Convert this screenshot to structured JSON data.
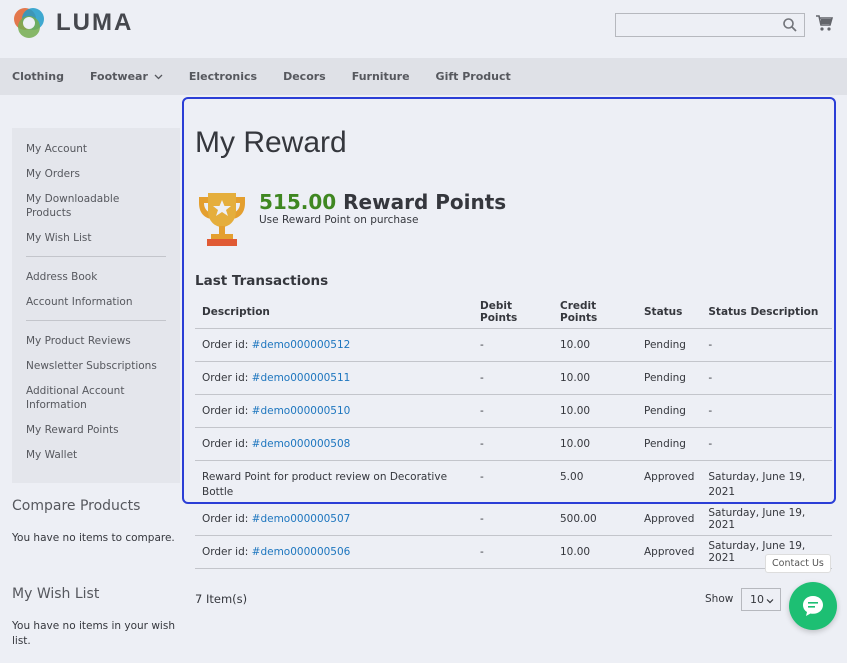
{
  "header": {
    "logo_text": "LUMA",
    "search": {
      "placeholder": ""
    }
  },
  "nav": {
    "items": [
      "Clothing",
      "Footwear",
      "Electronics",
      "Decors",
      "Furniture",
      "Gift Product"
    ]
  },
  "sidebar": {
    "group1": [
      "My Account",
      "My Orders",
      "My Downloadable Products",
      "My Wish List"
    ],
    "group2": [
      "Address Book",
      "Account Information"
    ],
    "group3": [
      "My Product Reviews",
      "Newsletter Subscriptions",
      "Additional Account Information",
      "My Reward Points",
      "My Wallet"
    ]
  },
  "compare": {
    "title": "Compare Products",
    "text": "You have no items to compare."
  },
  "wishlist": {
    "title": "My Wish List",
    "text": "You have no items in your wish list."
  },
  "main": {
    "title": "My Reward",
    "points_value": "515.00",
    "points_label": "Reward Points",
    "points_sub": "Use Reward Point on purchase",
    "section_title": "Last Transactions",
    "columns": [
      "Description",
      "Debit Points",
      "Credit Points",
      "Status",
      "Status Description"
    ],
    "rows": [
      {
        "prefix": "Order id: ",
        "link": "#demo000000512",
        "debit": "-",
        "credit": "10.00",
        "status": "Pending",
        "status_desc": "-"
      },
      {
        "prefix": "Order id: ",
        "link": "#demo000000511",
        "debit": "-",
        "credit": "10.00",
        "status": "Pending",
        "status_desc": "-"
      },
      {
        "prefix": "Order id: ",
        "link": "#demo000000510",
        "debit": "-",
        "credit": "10.00",
        "status": "Pending",
        "status_desc": "-"
      },
      {
        "prefix": "Order id: ",
        "link": "#demo000000508",
        "debit": "-",
        "credit": "10.00",
        "status": "Pending",
        "status_desc": "-"
      },
      {
        "prefix": "Reward Point for product review on Decorative Bottle",
        "link": "",
        "debit": "-",
        "credit": "5.00",
        "status": "Approved",
        "status_desc": "Saturday, June 19, 2021"
      },
      {
        "prefix": "Order id: ",
        "link": "#demo000000507",
        "debit": "-",
        "credit": "500.00",
        "status": "Approved",
        "status_desc": "Saturday, June 19, 2021"
      },
      {
        "prefix": "Order id: ",
        "link": "#demo000000506",
        "debit": "-",
        "credit": "10.00",
        "status": "Approved",
        "status_desc": "Saturday, June 19, 2021"
      }
    ],
    "items_count": "7 Item(s)",
    "show_label": "Show",
    "limiter_value": "10"
  },
  "widget": {
    "contact_label": "Contact Us"
  },
  "colors": {
    "points_green": "#3e8c14",
    "link_blue": "#1979c3",
    "highlight": "#2b3ed6",
    "chat_green": "#1dbf73"
  },
  "icons": [
    "luma-logo-icon",
    "search-icon",
    "cart-icon",
    "chevron-down-icon",
    "trophy-icon",
    "chat-icon"
  ]
}
